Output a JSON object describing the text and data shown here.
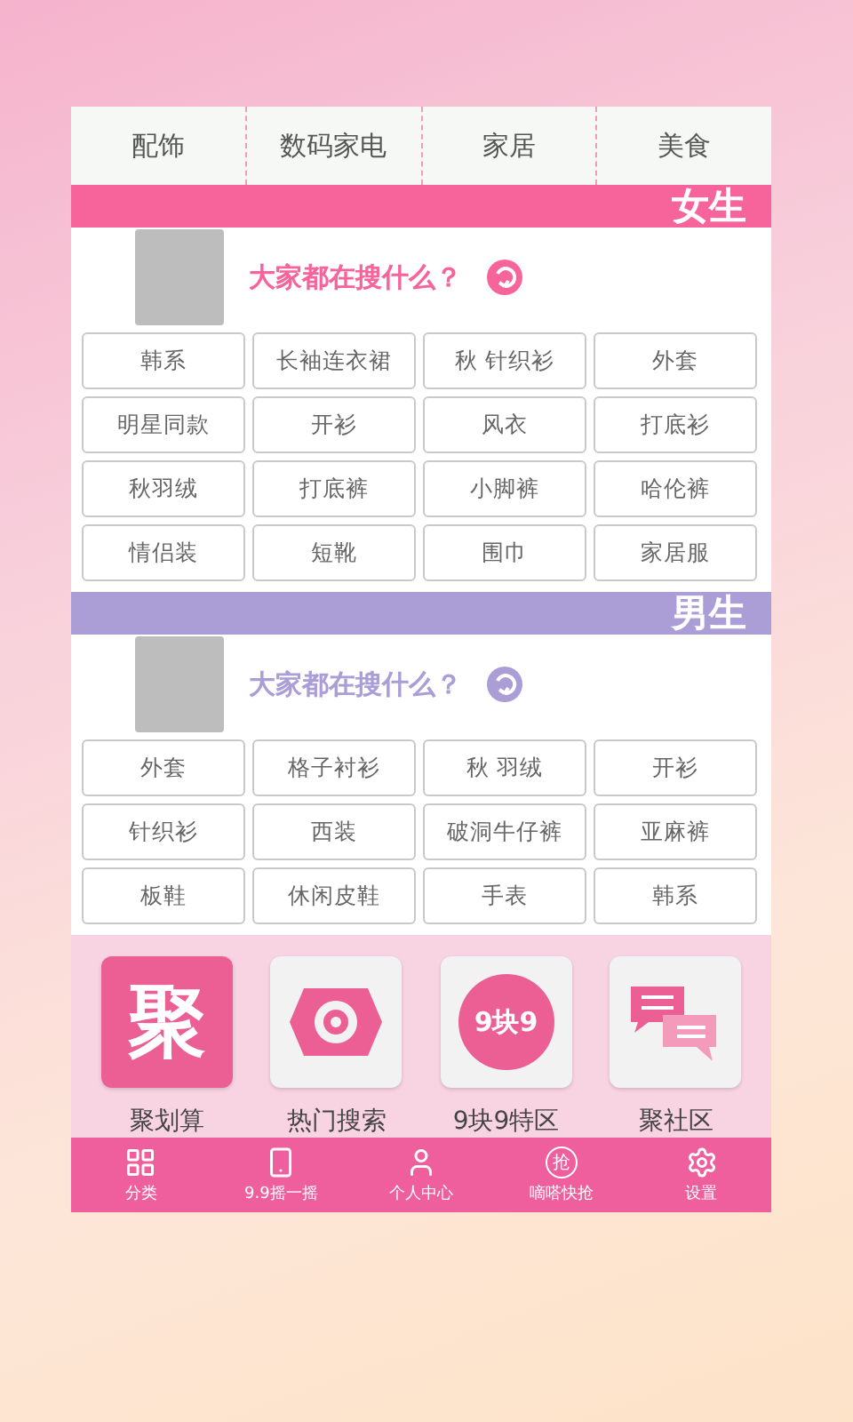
{
  "categories": [
    {
      "label": "配饰"
    },
    {
      "label": "数码家电"
    },
    {
      "label": "家居"
    },
    {
      "label": "美食"
    }
  ],
  "sections": [
    {
      "title": "女生",
      "color": "#f7649b",
      "prompt": "大家都在搜什么？",
      "tags": [
        "韩系",
        "长袖连衣裙",
        "秋 针织衫",
        "外套",
        "明星同款",
        "开衫",
        "风衣",
        "打底衫",
        "秋羽绒",
        "打底裤",
        "小脚裤",
        "哈伦裤",
        "情侣装",
        "短靴",
        "围巾",
        "家居服"
      ]
    },
    {
      "title": "男生",
      "color": "#ab9dd6",
      "prompt": "大家都在搜什么？",
      "tags": [
        "外套",
        "格子衬衫",
        "秋 羽绒",
        "开衫",
        "针织衫",
        "西装",
        "破洞牛仔裤",
        "亚麻裤",
        "板鞋",
        "休闲皮鞋",
        "手表",
        "韩系"
      ]
    }
  ],
  "features": [
    {
      "kind": "glyph",
      "icon_text": "聚",
      "label": "聚划算"
    },
    {
      "kind": "target",
      "label": "热门搜索"
    },
    {
      "kind": "bubble",
      "icon_text": "9块9",
      "label": "9块9特区"
    },
    {
      "kind": "chat",
      "label": "聚社区"
    }
  ],
  "nav": [
    {
      "kind": "grid",
      "label": "分类"
    },
    {
      "kind": "phone",
      "label": "9.9摇一摇"
    },
    {
      "kind": "person",
      "label": "个人中心"
    },
    {
      "kind": "badge",
      "icon_text": "抢",
      "label": "嘀嗒快抢"
    },
    {
      "kind": "gear",
      "label": "设置"
    }
  ]
}
